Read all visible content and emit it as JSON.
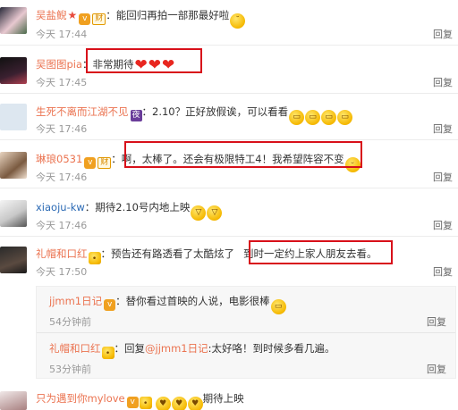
{
  "reply_label": "回复",
  "comments": [
    {
      "name": "吴盐鲵",
      "text": "：能回归再拍一部那最好啦",
      "time": "今天 17:44"
    },
    {
      "name": "吴图图pia",
      "text": "：非常期待",
      "time": "今天 17:45"
    },
    {
      "name": "生死不离而江湖不见",
      "text": "：2.10？正好放假诶，可以看看",
      "time": "今天 17:46"
    },
    {
      "name": "琳琅0531",
      "text": "：啊，太棒了。还会有极限特工4！我希望阵容不变",
      "time": "今天 17:46"
    },
    {
      "name": "xiaoju-kw",
      "text": "：期待2.10号内地上映",
      "time": "今天 17:46"
    },
    {
      "name": "礼帽和口红",
      "text": "：预告还有路透看了太酷炫了",
      "text2": "到时一定约上家人朋友去看。",
      "time": "今天 17:50"
    },
    {
      "name": "只为遇到你mylove",
      "text": "期待上映"
    }
  ],
  "sub_replies": [
    {
      "name": "jjmm1日记",
      "text": "：替你看过首映的人说，电影很棒",
      "time": "54分钟前"
    },
    {
      "name": "礼帽和口红",
      "text_prefix": "：回复",
      "mention": "@jjmm1日记",
      "text": ":太好咯！到时候多看几遍。",
      "time": "53分钟前"
    }
  ],
  "badges": {
    "cai": "财",
    "v": "v",
    "night": "夜"
  },
  "colors": {
    "name": "#eb7350",
    "link": "#2d6bb5",
    "highlight": "#d8101a"
  }
}
